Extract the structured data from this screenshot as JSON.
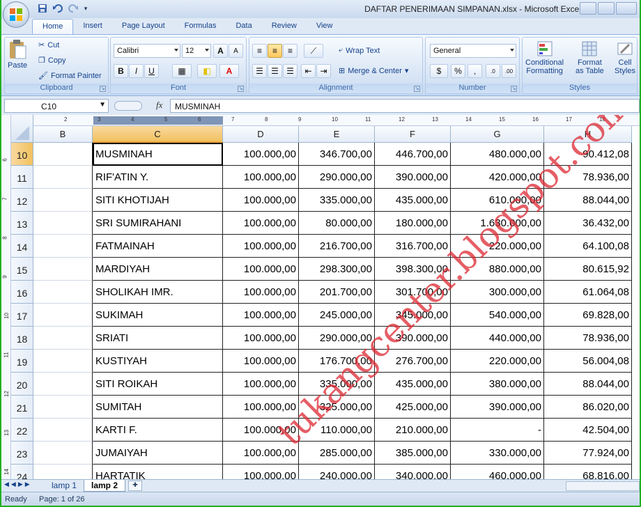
{
  "window": {
    "title": "DAFTAR PENERIMAAN SIMPANAN.xlsx - Microsoft Excel"
  },
  "ribbon_tabs": [
    "Home",
    "Insert",
    "Page Layout",
    "Formulas",
    "Data",
    "Review",
    "View"
  ],
  "clipboard": {
    "paste": "Paste",
    "cut": "Cut",
    "copy": "Copy",
    "format_painter": "Format Painter",
    "title": "Clipboard"
  },
  "font": {
    "name": "Calibri",
    "size": "12",
    "title": "Font",
    "bold": "B",
    "italic": "I",
    "underline": "U"
  },
  "alignment": {
    "wrap_text": "Wrap Text",
    "merge_center": "Merge & Center",
    "title": "Alignment"
  },
  "number": {
    "format": "General",
    "percent": "%",
    "comma": ",",
    "inc": "←.0 .00",
    "dec": ".00 →.0",
    "title": "Number"
  },
  "styles": {
    "conditional": "Conditional",
    "conditional2": "Formatting",
    "format_as": "Format",
    "format_as2": "as Table",
    "cell": "Cell",
    "cell2": "Styles",
    "title": "Styles"
  },
  "formula_bar": {
    "name_box": "C10",
    "fx": "fx",
    "content": "MUSMINAH"
  },
  "ruler_marks": [
    "2",
    "3",
    "4",
    "5",
    "6",
    "7",
    "8",
    "9",
    "10",
    "11",
    "12",
    "13",
    "14",
    "15",
    "16",
    "17",
    "18"
  ],
  "vruler_marks": [
    "6",
    "7",
    "8",
    "9",
    "10",
    "11",
    "12",
    "13",
    "14"
  ],
  "columns": [
    "B",
    "C",
    "D",
    "E",
    "F",
    "G",
    "H"
  ],
  "rows": [
    {
      "n": "10",
      "name": "MUSMINAH",
      "d": "100.000,00",
      "e": "346.700,00",
      "f": "446.700,00",
      "g": "480.000,00",
      "h": "90.412,08"
    },
    {
      "n": "11",
      "name": "RIF'ATIN Y.",
      "d": "100.000,00",
      "e": "290.000,00",
      "f": "390.000,00",
      "g": "420.000,00",
      "h": "78.936,00"
    },
    {
      "n": "12",
      "name": "SITI KHOTIJAH",
      "d": "100.000,00",
      "e": "335.000,00",
      "f": "435.000,00",
      "g": "610.000,00",
      "h": "88.044,00"
    },
    {
      "n": "13",
      "name": "SRI SUMIRAHANI",
      "d": "100.000,00",
      "e": "80.000,00",
      "f": "180.000,00",
      "g": "1.630.000,00",
      "h": "36.432,00"
    },
    {
      "n": "14",
      "name": "FATMAINAH",
      "d": "100.000,00",
      "e": "216.700,00",
      "f": "316.700,00",
      "g": "220.000,00",
      "h": "64.100,08"
    },
    {
      "n": "15",
      "name": "MARDIYAH",
      "d": "100.000,00",
      "e": "298.300,00",
      "f": "398.300,00",
      "g": "880.000,00",
      "h": "80.615,92"
    },
    {
      "n": "16",
      "name": "SHOLIKAH IMR.",
      "d": "100.000,00",
      "e": "201.700,00",
      "f": "301.700,00",
      "g": "300.000,00",
      "h": "61.064,08"
    },
    {
      "n": "17",
      "name": "SUKIMAH",
      "d": "100.000,00",
      "e": "245.000,00",
      "f": "345.000,00",
      "g": "540.000,00",
      "h": "69.828,00"
    },
    {
      "n": "18",
      "name": "SRIATI",
      "d": "100.000,00",
      "e": "290.000,00",
      "f": "390.000,00",
      "g": "440.000,00",
      "h": "78.936,00"
    },
    {
      "n": "19",
      "name": "KUSTIYAH",
      "d": "100.000,00",
      "e": "176.700,00",
      "f": "276.700,00",
      "g": "220.000,00",
      "h": "56.004,08"
    },
    {
      "n": "20",
      "name": "SITI ROIKAH",
      "d": "100.000,00",
      "e": "335.000,00",
      "f": "435.000,00",
      "g": "380.000,00",
      "h": "88.044,00"
    },
    {
      "n": "21",
      "name": "SUMITAH",
      "d": "100.000,00",
      "e": "325.000,00",
      "f": "425.000,00",
      "g": "390.000,00",
      "h": "86.020,00"
    },
    {
      "n": "22",
      "name": "KARTI F.",
      "d": "100.000,00",
      "e": "110.000,00",
      "f": "210.000,00",
      "g": "-",
      "h": "42.504,00"
    },
    {
      "n": "23",
      "name": "JUMAIYAH",
      "d": "100.000,00",
      "e": "285.000,00",
      "f": "385.000,00",
      "g": "330.000,00",
      "h": "77.924,00"
    },
    {
      "n": "24",
      "name": "HARTATIK",
      "d": "100.000,00",
      "e": "240.000,00",
      "f": "340.000,00",
      "g": "460.000,00",
      "h": "68.816,00"
    }
  ],
  "watermark": "tukangcenter.blogspot.com",
  "sheets": [
    "lamp 1",
    "lamp 2"
  ],
  "status": {
    "ready": "Ready",
    "page": "Page: 1 of 26"
  }
}
